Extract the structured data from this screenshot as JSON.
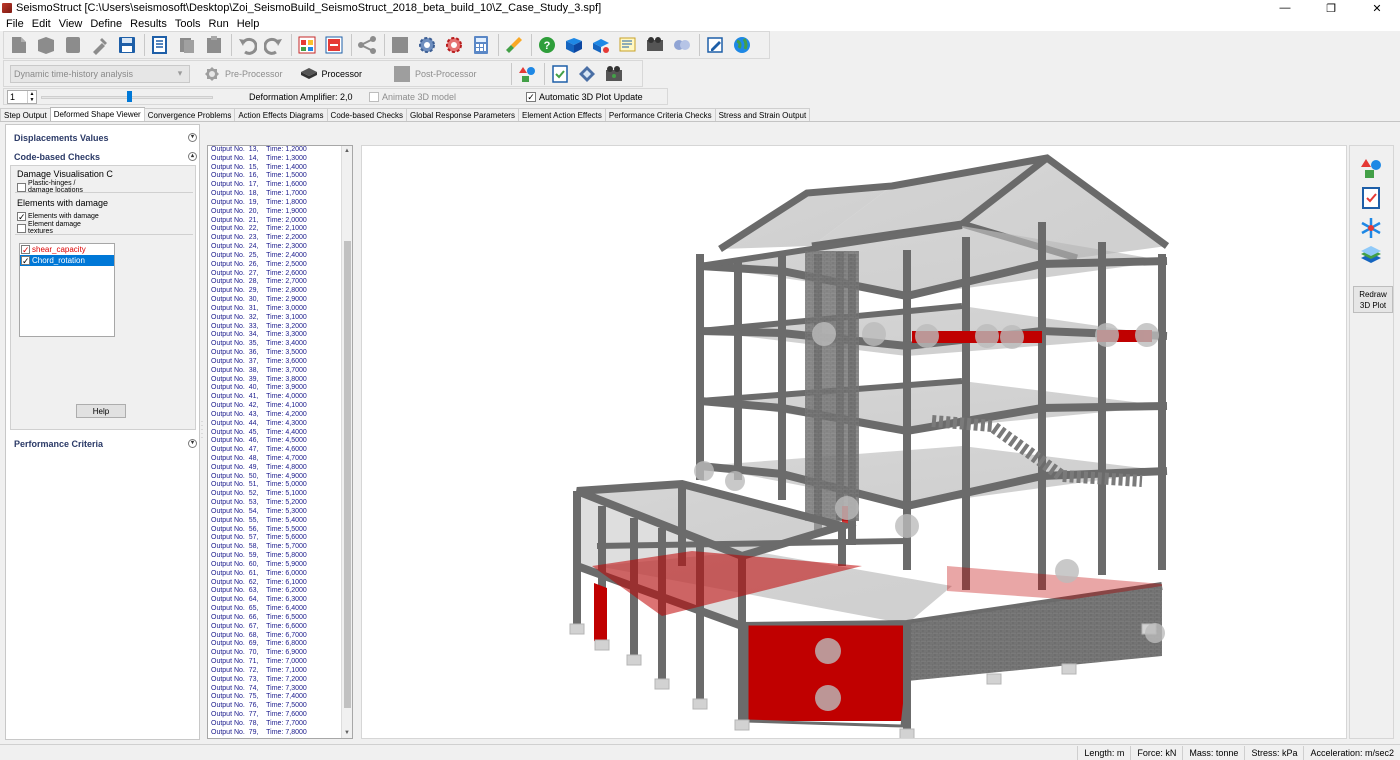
{
  "window": {
    "title": "SeismoStruct  [C:\\Users\\seismosoft\\Desktop\\Zoi_SeismoBuild_SeismoStruct_2018_beta_build_10\\Z_Case_Study_3.spf]",
    "minimize": "—",
    "maximize": "❐",
    "close": "✕"
  },
  "menu": [
    "File",
    "Edit",
    "View",
    "Define",
    "Results",
    "Tools",
    "Run",
    "Help"
  ],
  "toolbar2": {
    "analysis_type": "Dynamic time-history analysis",
    "pre_processor": "Pre-Processor",
    "processor": "Processor",
    "post_processor": "Post-Processor"
  },
  "toolbar3": {
    "step_value": "1",
    "slider_fraction": 0.5,
    "deformation_amplifier": "Deformation Amplifier: 2,0",
    "animate_label": "Animate 3D model",
    "animate_checked": false,
    "auto_update_label": "Automatic 3D Plot Update",
    "auto_update_checked": true
  },
  "tabs": [
    "Step Output",
    "Deformed Shape Viewer",
    "Convergence Problems",
    "Action Effects Diagrams",
    "Code-based Checks",
    "Global Response Parameters",
    "Element Action Effects",
    "Performance Criteria Checks",
    "Stress and Strain Output"
  ],
  "selected_tab": "Deformed Shape Viewer",
  "left_panel": {
    "displacements": "Displacements Values",
    "code_checks": "Code-based Checks",
    "damage_group": "Damage Visualisation C",
    "damage_opt1a": "Plastic-hinges /",
    "damage_opt1b": "damage locations",
    "elements_group": "Elements with damage",
    "elements_opt1": "Elements with damage",
    "elements_opt2a": "Element damage",
    "elements_opt2b": "textures",
    "checks": [
      {
        "label": "shear_capacity",
        "checked": true
      },
      {
        "label": "Chord_rotation",
        "checked": true
      }
    ],
    "help": "Help",
    "performance": "Performance Criteria"
  },
  "outputs": [
    [
      "13",
      "1,2000"
    ],
    [
      "14",
      "1,3000"
    ],
    [
      "15",
      "1,4000"
    ],
    [
      "16",
      "1,5000"
    ],
    [
      "17",
      "1,6000"
    ],
    [
      "18",
      "1,7000"
    ],
    [
      "19",
      "1,8000"
    ],
    [
      "20",
      "1,9000"
    ],
    [
      "21",
      "2,0000"
    ],
    [
      "22",
      "2,1000"
    ],
    [
      "23",
      "2,2000"
    ],
    [
      "24",
      "2,3000"
    ],
    [
      "25",
      "2,4000"
    ],
    [
      "26",
      "2,5000"
    ],
    [
      "27",
      "2,6000"
    ],
    [
      "28",
      "2,7000"
    ],
    [
      "29",
      "2,8000"
    ],
    [
      "30",
      "2,9000"
    ],
    [
      "31",
      "3,0000"
    ],
    [
      "32",
      "3,1000"
    ],
    [
      "33",
      "3,2000"
    ],
    [
      "34",
      "3,3000"
    ],
    [
      "35",
      "3,4000"
    ],
    [
      "36",
      "3,5000"
    ],
    [
      "37",
      "3,6000"
    ],
    [
      "38",
      "3,7000"
    ],
    [
      "39",
      "3,8000"
    ],
    [
      "40",
      "3,9000"
    ],
    [
      "41",
      "4,0000"
    ],
    [
      "42",
      "4,1000"
    ],
    [
      "43",
      "4,2000"
    ],
    [
      "44",
      "4,3000"
    ],
    [
      "45",
      "4,4000"
    ],
    [
      "46",
      "4,5000"
    ],
    [
      "47",
      "4,6000"
    ],
    [
      "48",
      "4,7000"
    ],
    [
      "49",
      "4,8000"
    ],
    [
      "50",
      "4,9000"
    ],
    [
      "51",
      "5,0000"
    ],
    [
      "52",
      "5,1000"
    ],
    [
      "53",
      "5,2000"
    ],
    [
      "54",
      "5,3000"
    ],
    [
      "55",
      "5,4000"
    ],
    [
      "56",
      "5,5000"
    ],
    [
      "57",
      "5,6000"
    ],
    [
      "58",
      "5,7000"
    ],
    [
      "59",
      "5,8000"
    ],
    [
      "60",
      "5,9000"
    ],
    [
      "61",
      "6,0000"
    ],
    [
      "62",
      "6,1000"
    ],
    [
      "63",
      "6,2000"
    ],
    [
      "64",
      "6,3000"
    ],
    [
      "65",
      "6,4000"
    ],
    [
      "66",
      "6,5000"
    ],
    [
      "67",
      "6,6000"
    ],
    [
      "68",
      "6,7000"
    ],
    [
      "69",
      "6,8000"
    ],
    [
      "70",
      "6,9000"
    ],
    [
      "71",
      "7,0000"
    ],
    [
      "72",
      "7,1000"
    ],
    [
      "73",
      "7,2000"
    ],
    [
      "74",
      "7,3000"
    ],
    [
      "75",
      "7,4000"
    ],
    [
      "76",
      "7,5000"
    ],
    [
      "77",
      "7,6000"
    ],
    [
      "78",
      "7,7000"
    ],
    [
      "79",
      "7,8000"
    ]
  ],
  "output_prefix": "Output No.",
  "time_prefix": "Time:",
  "right_strip": {
    "redraw_line1": "Redraw",
    "redraw_line2": "3D Plot"
  },
  "status": {
    "length": "Length: m",
    "force": "Force: kN",
    "mass": "Mass: tonne",
    "stress": "Stress: kPa",
    "acceleration": "Acceleration: m/sec2"
  },
  "colors": {
    "frame": "#707070",
    "damage": "#c00000",
    "slab": "#b8b8b8",
    "selection": "#0078d7"
  }
}
